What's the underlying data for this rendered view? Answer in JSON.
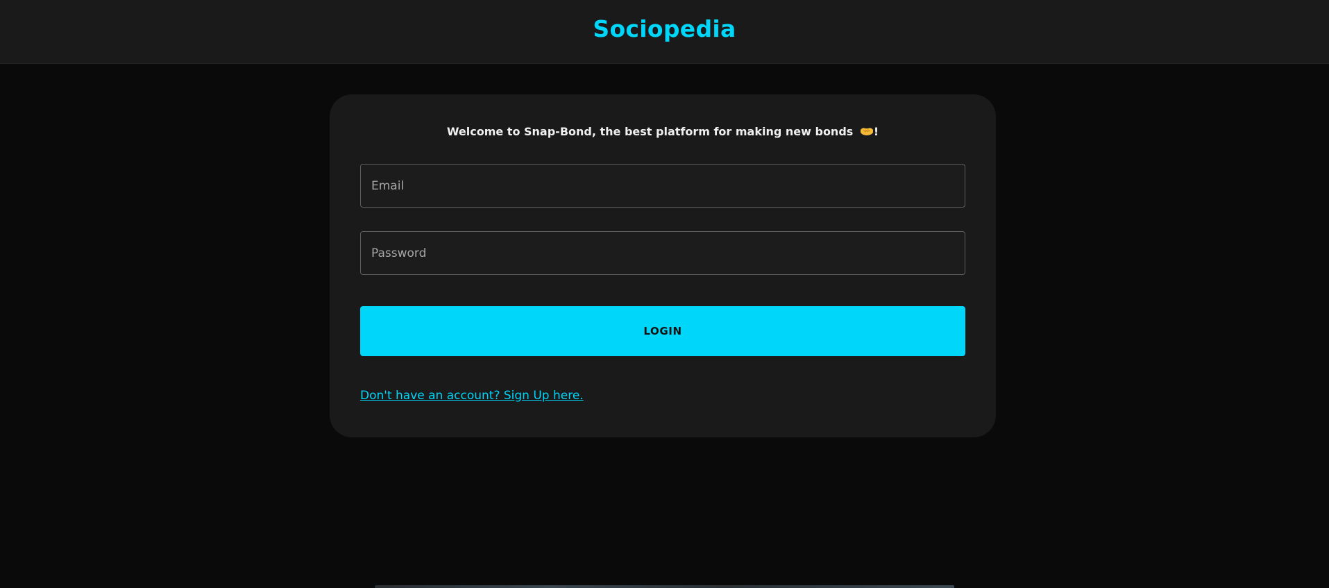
{
  "header": {
    "brand": "Sociopedia"
  },
  "login_form": {
    "welcome_text": "Welcome to Snap-Bond, the best platform for making new bonds",
    "welcome_emoji_icon": "handshake-icon",
    "welcome_suffix": "!",
    "email": {
      "placeholder": "Email",
      "value": ""
    },
    "password": {
      "placeholder": "Password",
      "value": ""
    },
    "login_label": "LOGIN",
    "signup_link": "Don't have an account? Sign Up here."
  },
  "colors": {
    "accent": "#00d5fa",
    "page_background": "#0a0a0a",
    "card_background": "#1a1a1a",
    "header_background": "#1a1a1a"
  }
}
